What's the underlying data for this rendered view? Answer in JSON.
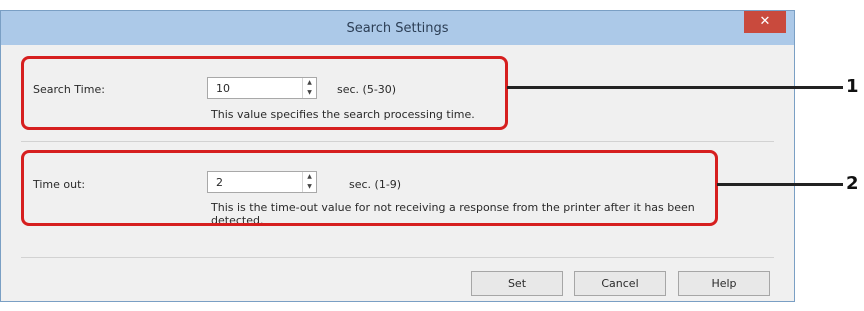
{
  "dialog": {
    "title": "Search Settings",
    "close_label": "✕"
  },
  "search_time": {
    "label": "Search Time:",
    "value": "10",
    "unit": "sec. (5-30)",
    "description": "This value specifies the search processing time."
  },
  "time_out": {
    "label": "Time out:",
    "value": "2",
    "unit": "sec. (1-9)",
    "description": "This is the time-out value for not receiving a response from the printer after it has been detected."
  },
  "buttons": {
    "set": "Set",
    "cancel": "Cancel",
    "help": "Help"
  },
  "spinner": {
    "up": "▲",
    "down": "▼"
  },
  "callouts": {
    "one": "1",
    "two": "2"
  },
  "colors": {
    "highlight": "#d61f1f",
    "titlebar": "#acc9e8",
    "close": "#c94a3d"
  }
}
